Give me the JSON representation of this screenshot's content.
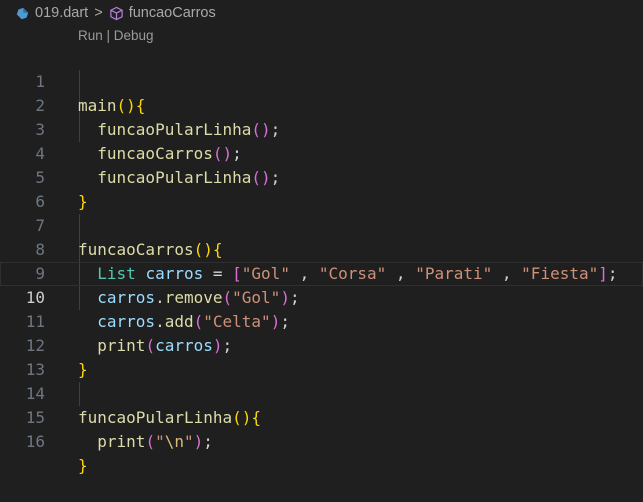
{
  "breadcrumb": {
    "file": "019.dart",
    "symbol": "funcaoCarros",
    "separator": ">"
  },
  "codelens": {
    "run": "Run",
    "sep": " | ",
    "debug": "Debug"
  },
  "editor": {
    "current_line": 10,
    "lines": [
      {
        "n": "1"
      },
      {
        "n": "2"
      },
      {
        "n": "3"
      },
      {
        "n": "4"
      },
      {
        "n": "5"
      },
      {
        "n": "6"
      },
      {
        "n": "7"
      },
      {
        "n": "8"
      },
      {
        "n": "9"
      },
      {
        "n": "10"
      },
      {
        "n": "11"
      },
      {
        "n": "12"
      },
      {
        "n": "13"
      },
      {
        "n": "14"
      },
      {
        "n": "15"
      },
      {
        "n": "16"
      }
    ],
    "tokens": {
      "main": "main",
      "funcaoPularLinha": "funcaoPularLinha",
      "funcaoCarros": "funcaoCarros",
      "List": "List",
      "carros": "carros",
      "remove": "remove",
      "add": "add",
      "print": "print",
      "gol": "\"Gol\"",
      "corsa": "\"Corsa\"",
      "parati": "\"Parati\"",
      "fiesta": "\"Fiesta\"",
      "celta": "\"Celta\"",
      "quote": "\"",
      "newline": "\\n"
    }
  },
  "colors": {
    "background": "#1f1f1f",
    "function": "#dcdcaa",
    "type": "#4ec9b0",
    "variable": "#9cdcfe",
    "string": "#ce9178",
    "escape": "#d7ba7d",
    "bracket_level1": "#ffd700",
    "bracket_level2": "#da70d6",
    "bracket_level3": "#179fff"
  }
}
